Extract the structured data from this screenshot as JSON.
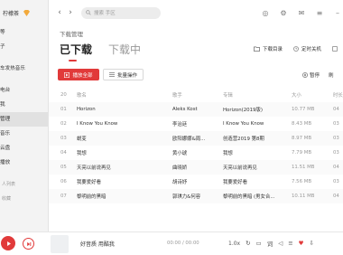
{
  "sidebar": {
    "user_name": "柠檬茶",
    "items": [
      "等",
      "子",
      "",
      "车发热音乐",
      "",
      "电台",
      "我",
      "管理",
      "音乐",
      "云盘",
      "播放",
      "",
      "",
      "人列表",
      "收藏"
    ]
  },
  "toolbar": {
    "search_placeholder": "搜索 手区"
  },
  "page": {
    "breadcrumb": "下载管理",
    "tabs": [
      "已下载",
      "下载中"
    ],
    "song_catalog": "下载目录",
    "auto_shutdown": "定时关机",
    "play_all": "播放全部",
    "batch": "批量操作",
    "pause": "暂停",
    "refresh": "刷"
  },
  "table": {
    "headers": [
      "20",
      "歌名",
      "歌手",
      "专辑",
      "大小",
      "时长"
    ],
    "rows": [
      {
        "idx": "01",
        "title": "Horizon",
        "artist": "Aleks Kost",
        "album": "Horizon(2019版)",
        "size": "10.77 MB",
        "time": "04"
      },
      {
        "idx": "02",
        "title": "I Know You Know",
        "artist": "李治廷",
        "album": "I Know You Know",
        "size": "8.43 MB",
        "time": "03"
      },
      {
        "idx": "03",
        "title": "蜕变",
        "artist": "欧阳娜娜&周...",
        "album": "创造营2019 第8期",
        "size": "8.97 MB",
        "time": "03"
      },
      {
        "idx": "04",
        "title": "我想",
        "artist": "黄小琥",
        "album": "我想",
        "size": "7.79 MB",
        "time": "03"
      },
      {
        "idx": "05",
        "title": "天亮以前说再见",
        "artist": "曲晓娇",
        "album": "天亮以前说再见",
        "size": "11.51 MB",
        "time": "04"
      },
      {
        "idx": "06",
        "title": "我要爱好看",
        "artist": "胡诗妤",
        "album": "我要爱好看",
        "size": "7.56 MB",
        "time": "03"
      },
      {
        "idx": "07",
        "title": "黎明前的黑暗",
        "artist": "郭琪力&何容",
        "album": "黎明前的黑暗 (男女合...",
        "size": "10.11 MB",
        "time": "04"
      }
    ]
  },
  "player": {
    "title": "好音质 用酷我",
    "time": "00:00 / 00:00",
    "speed": "1.0x"
  },
  "colors": {
    "accent": "#e13a3a"
  }
}
